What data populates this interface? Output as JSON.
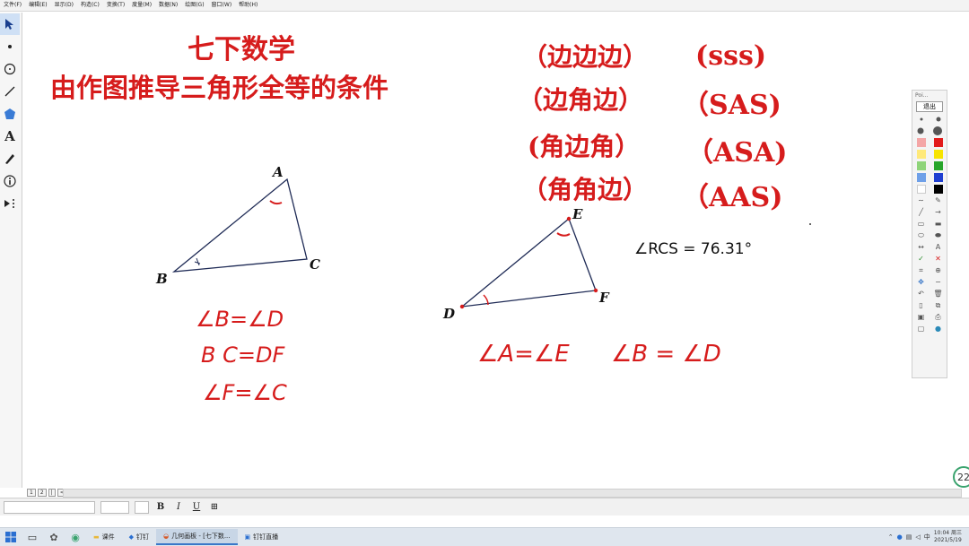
{
  "menu": [
    "文件(F)",
    "编辑(E)",
    "显示(D)",
    "构造(C)",
    "变换(T)",
    "度量(M)",
    "数据(N)",
    "绘图(G)",
    "窗口(W)",
    "帮助(H)"
  ],
  "titles": {
    "line1": "七下数学",
    "line2": "由作图推导三角形全等的条件"
  },
  "criteria": [
    {
      "cn": "（边边边）",
      "abbr": "(sss)"
    },
    {
      "cn": "（边角边）",
      "abbr": "（SAS)"
    },
    {
      "cn": "(角边角）",
      "abbr": "（ASA)"
    },
    {
      "cn": "（角角边）",
      "abbr": "（AAS)"
    }
  ],
  "measurement": "∠RCS = 76.31°",
  "triangle1": {
    "A": "A",
    "B": "B",
    "C": "C"
  },
  "triangle2": {
    "D": "D",
    "E": "E",
    "F": "F"
  },
  "notes_left": [
    "∠B=∠D",
    "B C=DF",
    "∠F=∠C"
  ],
  "notes_right": [
    "∠A=∠E",
    "∠B = ∠D"
  ],
  "panel": {
    "title": "Poi...",
    "exit": "退出",
    "colors": [
      "#f4a6a6",
      "#e21b1b",
      "#ffe97a",
      "#f7e400",
      "#8fd47a",
      "#27a52a",
      "#6fa0e8",
      "#1f3fd1",
      "#ffffff",
      "#000000"
    ]
  },
  "page_tabs": [
    "1",
    "2",
    "|",
    "<"
  ],
  "format": {
    "bold": "B",
    "italic": "I",
    "underline": "U"
  },
  "taskbar": {
    "apps": [
      "课件",
      "钉钉",
      "几何画板 - [七下数...",
      "钉钉直播"
    ],
    "time": "10:04 周三",
    "date": "2021/5/19"
  },
  "badge": "22"
}
